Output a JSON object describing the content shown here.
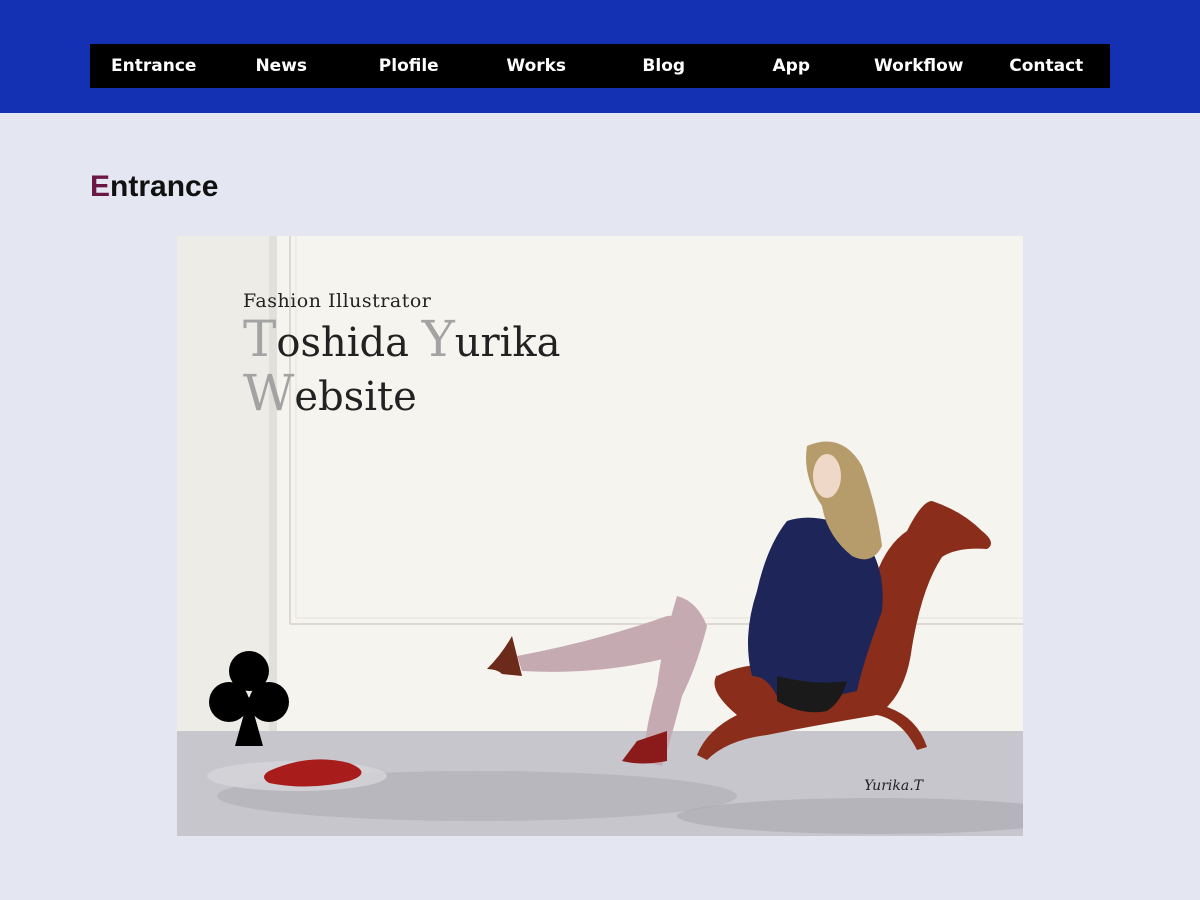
{
  "nav": {
    "items": [
      {
        "label": "Entrance"
      },
      {
        "label": "News"
      },
      {
        "label": "Plofile"
      },
      {
        "label": "Works"
      },
      {
        "label": "Blog"
      },
      {
        "label": "App"
      },
      {
        "label": "Workflow"
      },
      {
        "label": "Contact"
      }
    ]
  },
  "page": {
    "title_first_letter": "E",
    "title_rest": "ntrance"
  },
  "hero": {
    "subtitle": "Fashion  Illustrator",
    "name_first_cap": "T",
    "name_first_rest": "oshida ",
    "name_second_cap": "Y",
    "name_second_rest": "urika",
    "site_cap": "W",
    "site_rest": "ebsite",
    "signature": "Yurika.T"
  },
  "colors": {
    "header_bg": "#1531b3",
    "nav_bg": "#000000",
    "page_bg": "#e4e6f2",
    "title_accent": "#6a1748"
  }
}
